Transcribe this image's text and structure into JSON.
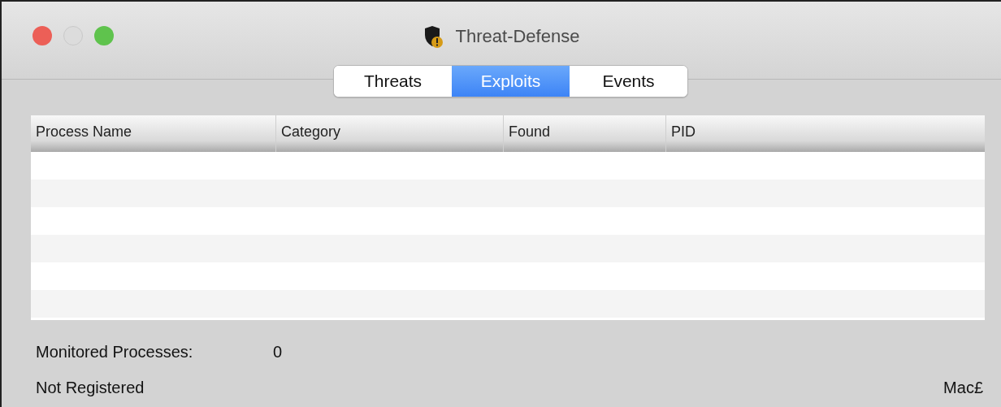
{
  "window": {
    "title": "Threat-Defense"
  },
  "tabs": [
    {
      "label": "Threats",
      "selected": false
    },
    {
      "label": "Exploits",
      "selected": true
    },
    {
      "label": "Events",
      "selected": false
    }
  ],
  "table": {
    "columns": [
      "Process Name",
      "Category",
      "Found",
      "PID"
    ]
  },
  "status": {
    "monitored_label": "Monitored Processes:",
    "monitored_value": "0",
    "registration": "Not Registered",
    "right_text": "Mac£"
  }
}
